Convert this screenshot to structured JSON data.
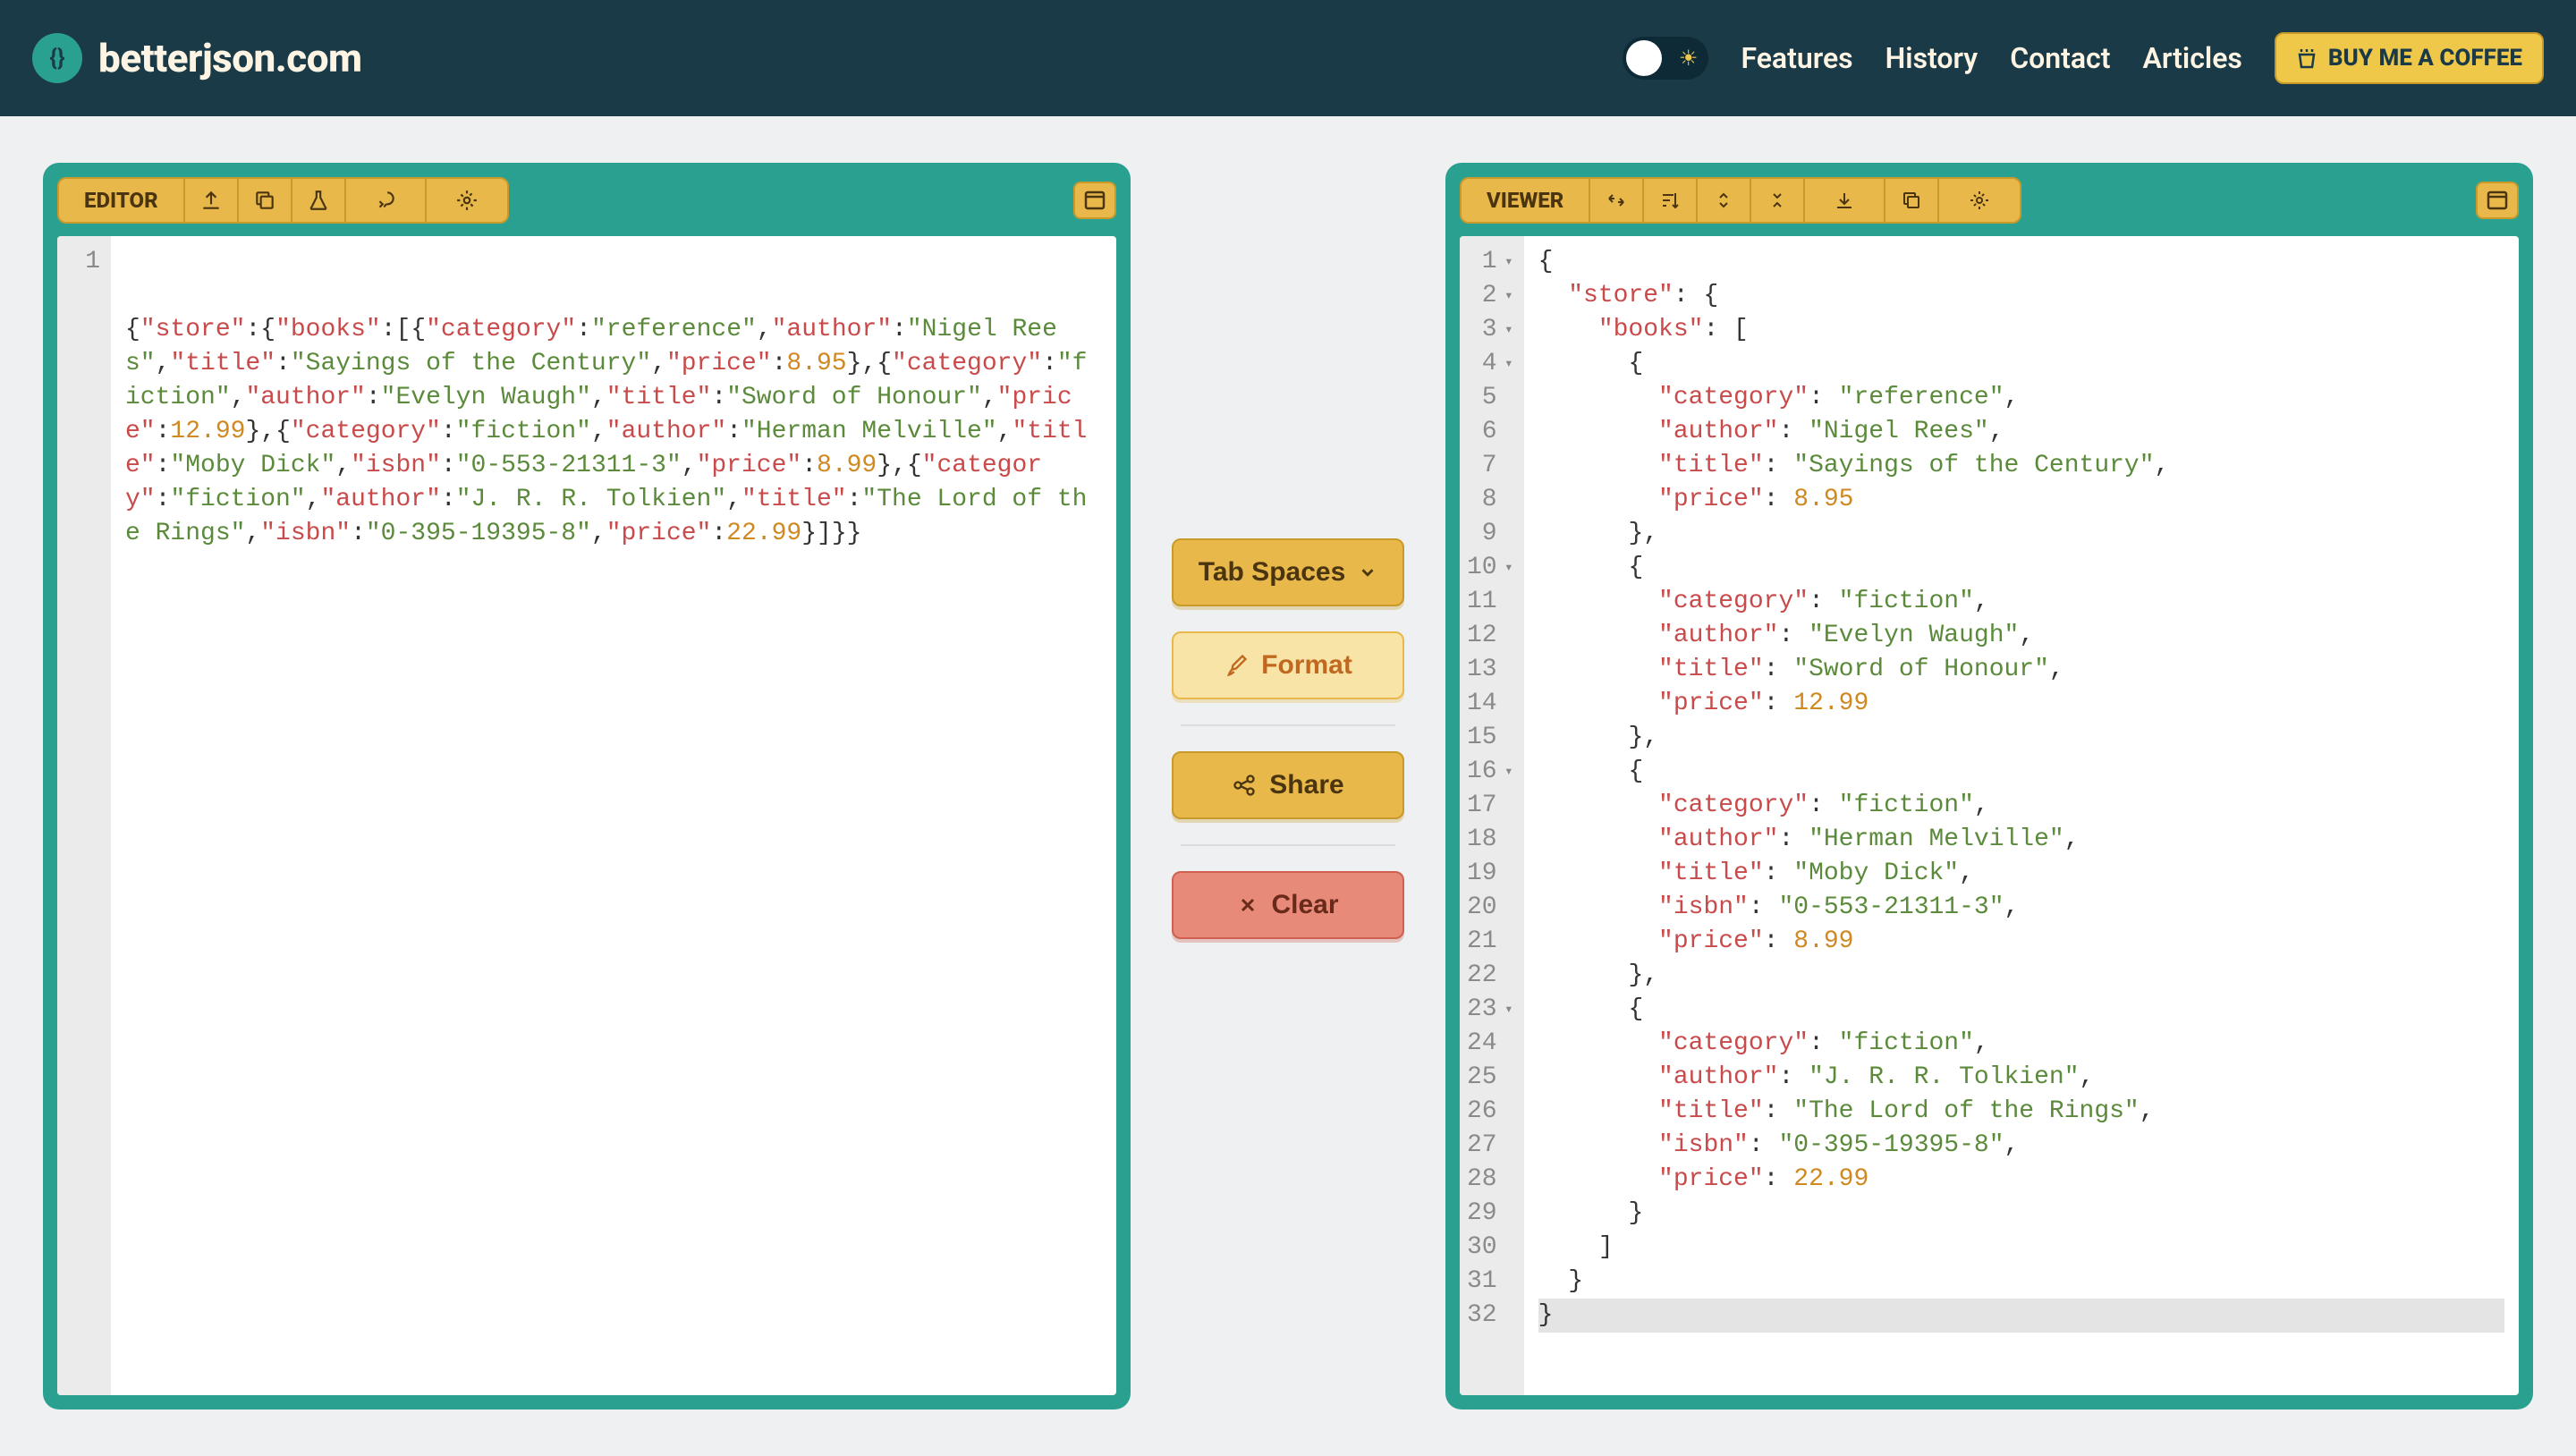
{
  "header": {
    "logo": "betterjson.com",
    "nav": [
      "Features",
      "History",
      "Contact",
      "Articles"
    ],
    "coffee": "BUY ME A COFFEE"
  },
  "editor": {
    "label": "EDITOR",
    "line_number": "1",
    "json": {
      "store": {
        "books": [
          {
            "category": "reference",
            "author": "Nigel Rees",
            "title": "Sayings of the Century",
            "price": 8.95
          },
          {
            "category": "fiction",
            "author": "Evelyn Waugh",
            "title": "Sword of Honour",
            "price": 12.99
          },
          {
            "category": "fiction",
            "author": "Herman Melville",
            "title": "Moby Dick",
            "isbn": "0-553-21311-3",
            "price": 8.99
          },
          {
            "category": "fiction",
            "author": "J. R. R. Tolkien",
            "title": "The Lord of the Rings",
            "isbn": "0-395-19395-8",
            "price": 22.99
          }
        ]
      }
    }
  },
  "middle": {
    "tab_spaces": "Tab Spaces",
    "format": "Format",
    "share": "Share",
    "clear": "Clear"
  },
  "viewer": {
    "label": "VIEWER",
    "lines": [
      {
        "n": 1,
        "fold": true,
        "indent": 0,
        "tokens": [
          [
            "punc",
            "{"
          ]
        ]
      },
      {
        "n": 2,
        "fold": true,
        "indent": 1,
        "tokens": [
          [
            "key",
            "\"store\""
          ],
          [
            "punc",
            ": {"
          ]
        ]
      },
      {
        "n": 3,
        "fold": true,
        "indent": 2,
        "tokens": [
          [
            "key",
            "\"books\""
          ],
          [
            "punc",
            ": ["
          ]
        ]
      },
      {
        "n": 4,
        "fold": true,
        "indent": 3,
        "tokens": [
          [
            "punc",
            "{"
          ]
        ]
      },
      {
        "n": 5,
        "indent": 4,
        "tokens": [
          [
            "key",
            "\"category\""
          ],
          [
            "punc",
            ": "
          ],
          [
            "str",
            "\"reference\""
          ],
          [
            "punc",
            ","
          ]
        ]
      },
      {
        "n": 6,
        "indent": 4,
        "tokens": [
          [
            "key",
            "\"author\""
          ],
          [
            "punc",
            ": "
          ],
          [
            "str",
            "\"Nigel Rees\""
          ],
          [
            "punc",
            ","
          ]
        ]
      },
      {
        "n": 7,
        "indent": 4,
        "tokens": [
          [
            "key",
            "\"title\""
          ],
          [
            "punc",
            ": "
          ],
          [
            "str",
            "\"Sayings of the Century\""
          ],
          [
            "punc",
            ","
          ]
        ]
      },
      {
        "n": 8,
        "indent": 4,
        "tokens": [
          [
            "key",
            "\"price\""
          ],
          [
            "punc",
            ": "
          ],
          [
            "num",
            "8.95"
          ]
        ]
      },
      {
        "n": 9,
        "indent": 3,
        "tokens": [
          [
            "punc",
            "},"
          ]
        ]
      },
      {
        "n": 10,
        "fold": true,
        "indent": 3,
        "tokens": [
          [
            "punc",
            "{"
          ]
        ]
      },
      {
        "n": 11,
        "indent": 4,
        "tokens": [
          [
            "key",
            "\"category\""
          ],
          [
            "punc",
            ": "
          ],
          [
            "str",
            "\"fiction\""
          ],
          [
            "punc",
            ","
          ]
        ]
      },
      {
        "n": 12,
        "indent": 4,
        "tokens": [
          [
            "key",
            "\"author\""
          ],
          [
            "punc",
            ": "
          ],
          [
            "str",
            "\"Evelyn Waugh\""
          ],
          [
            "punc",
            ","
          ]
        ]
      },
      {
        "n": 13,
        "indent": 4,
        "tokens": [
          [
            "key",
            "\"title\""
          ],
          [
            "punc",
            ": "
          ],
          [
            "str",
            "\"Sword of Honour\""
          ],
          [
            "punc",
            ","
          ]
        ]
      },
      {
        "n": 14,
        "indent": 4,
        "tokens": [
          [
            "key",
            "\"price\""
          ],
          [
            "punc",
            ": "
          ],
          [
            "num",
            "12.99"
          ]
        ]
      },
      {
        "n": 15,
        "indent": 3,
        "tokens": [
          [
            "punc",
            "},"
          ]
        ]
      },
      {
        "n": 16,
        "fold": true,
        "indent": 3,
        "tokens": [
          [
            "punc",
            "{"
          ]
        ]
      },
      {
        "n": 17,
        "indent": 4,
        "tokens": [
          [
            "key",
            "\"category\""
          ],
          [
            "punc",
            ": "
          ],
          [
            "str",
            "\"fiction\""
          ],
          [
            "punc",
            ","
          ]
        ]
      },
      {
        "n": 18,
        "indent": 4,
        "tokens": [
          [
            "key",
            "\"author\""
          ],
          [
            "punc",
            ": "
          ],
          [
            "str",
            "\"Herman Melville\""
          ],
          [
            "punc",
            ","
          ]
        ]
      },
      {
        "n": 19,
        "indent": 4,
        "tokens": [
          [
            "key",
            "\"title\""
          ],
          [
            "punc",
            ": "
          ],
          [
            "str",
            "\"Moby Dick\""
          ],
          [
            "punc",
            ","
          ]
        ]
      },
      {
        "n": 20,
        "indent": 4,
        "tokens": [
          [
            "key",
            "\"isbn\""
          ],
          [
            "punc",
            ": "
          ],
          [
            "str",
            "\"0-553-21311-3\""
          ],
          [
            "punc",
            ","
          ]
        ]
      },
      {
        "n": 21,
        "indent": 4,
        "tokens": [
          [
            "key",
            "\"price\""
          ],
          [
            "punc",
            ": "
          ],
          [
            "num",
            "8.99"
          ]
        ]
      },
      {
        "n": 22,
        "indent": 3,
        "tokens": [
          [
            "punc",
            "},"
          ]
        ]
      },
      {
        "n": 23,
        "fold": true,
        "indent": 3,
        "tokens": [
          [
            "punc",
            "{"
          ]
        ]
      },
      {
        "n": 24,
        "indent": 4,
        "tokens": [
          [
            "key",
            "\"category\""
          ],
          [
            "punc",
            ": "
          ],
          [
            "str",
            "\"fiction\""
          ],
          [
            "punc",
            ","
          ]
        ]
      },
      {
        "n": 25,
        "indent": 4,
        "tokens": [
          [
            "key",
            "\"author\""
          ],
          [
            "punc",
            ": "
          ],
          [
            "str",
            "\"J. R. R. Tolkien\""
          ],
          [
            "punc",
            ","
          ]
        ]
      },
      {
        "n": 26,
        "indent": 4,
        "tokens": [
          [
            "key",
            "\"title\""
          ],
          [
            "punc",
            ": "
          ],
          [
            "str",
            "\"The Lord of the Rings\""
          ],
          [
            "punc",
            ","
          ]
        ]
      },
      {
        "n": 27,
        "indent": 4,
        "tokens": [
          [
            "key",
            "\"isbn\""
          ],
          [
            "punc",
            ": "
          ],
          [
            "str",
            "\"0-395-19395-8\""
          ],
          [
            "punc",
            ","
          ]
        ]
      },
      {
        "n": 28,
        "indent": 4,
        "tokens": [
          [
            "key",
            "\"price\""
          ],
          [
            "punc",
            ": "
          ],
          [
            "num",
            "22.99"
          ]
        ]
      },
      {
        "n": 29,
        "indent": 3,
        "tokens": [
          [
            "punc",
            "}"
          ]
        ]
      },
      {
        "n": 30,
        "indent": 2,
        "tokens": [
          [
            "punc",
            "]"
          ]
        ]
      },
      {
        "n": 31,
        "indent": 1,
        "tokens": [
          [
            "punc",
            "}"
          ]
        ]
      },
      {
        "n": 32,
        "indent": 0,
        "hl": true,
        "tokens": [
          [
            "punc",
            "}"
          ]
        ]
      }
    ]
  }
}
